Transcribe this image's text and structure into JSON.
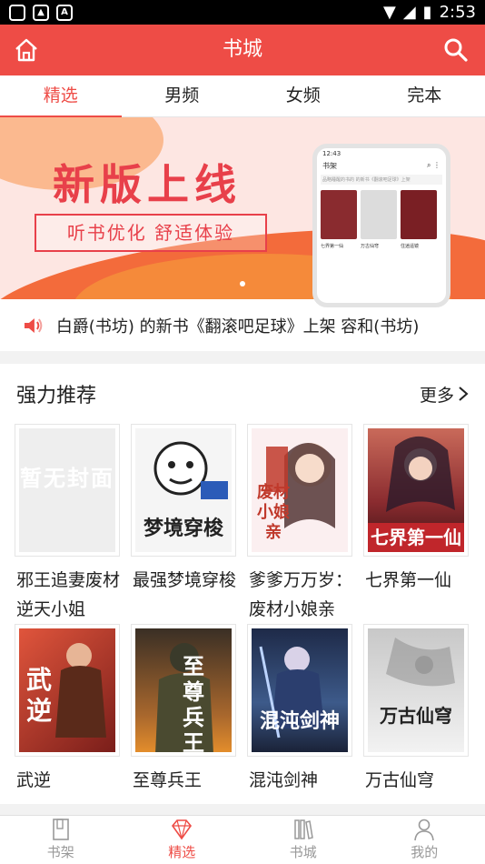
{
  "status_bar": {
    "time": "2:53"
  },
  "header": {
    "title": "书城"
  },
  "tabs": [
    {
      "label": "精选",
      "active": true
    },
    {
      "label": "男频",
      "active": false
    },
    {
      "label": "女频",
      "active": false
    },
    {
      "label": "完本",
      "active": false
    }
  ],
  "banner": {
    "headline": "新版上线",
    "subline": "听书优化 舒适体验",
    "phone_preview": {
      "status_time": "12:43",
      "title": "书架",
      "note": "品略睡醒的书的 的新书《翻滚吧足球》上架",
      "books": [
        "七界第一仙",
        "万古仙穹",
        "住逍遥镜"
      ]
    }
  },
  "notice": {
    "text": "白爵(书坊) 的新书《翻滚吧足球》上架    容和(书坊)"
  },
  "section": {
    "title": "强力推荐",
    "more": "更多"
  },
  "books": [
    {
      "title": "邪王追妻废材逆天小姐",
      "cover_text": "暂无封面",
      "cover_color": "#eeeeee"
    },
    {
      "title": "最强梦境穿梭",
      "cover_text": "梦境穿梭",
      "cover_color": "#f5f5f5"
    },
    {
      "title": "爹爹万万岁：废材小娘亲",
      "cover_text": "废材小娘亲",
      "cover_color": "#fbeff0"
    },
    {
      "title": "七界第一仙",
      "cover_text": "七界第一仙",
      "cover_color": "#8a2b2f"
    },
    {
      "title": "武逆",
      "cover_text": "武逆",
      "cover_color": "#b83a2a"
    },
    {
      "title": "至尊兵王",
      "cover_text": "至尊兵王",
      "cover_color": "#6b4a2a"
    },
    {
      "title": "混沌剑神",
      "cover_text": "混沌剑神",
      "cover_color": "#2c3e66"
    },
    {
      "title": "万古仙穹",
      "cover_text": "万古仙穹",
      "cover_color": "#dcdcdc"
    }
  ],
  "bottom_nav": [
    {
      "label": "书架",
      "icon": "bookshelf-icon",
      "active": false
    },
    {
      "label": "精选",
      "icon": "diamond-icon",
      "active": true
    },
    {
      "label": "书城",
      "icon": "books-icon",
      "active": false
    },
    {
      "label": "我的",
      "icon": "person-icon",
      "active": false
    }
  ],
  "colors": {
    "accent": "#ee4c46",
    "text": "#222222",
    "muted": "#999999"
  }
}
